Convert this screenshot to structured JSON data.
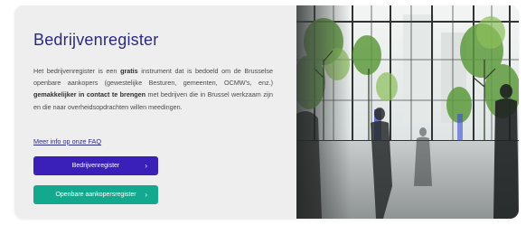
{
  "panel": {
    "title": "Bedrijvenregister",
    "intro": [
      "Het bedrijvenregister is een ",
      "gratis",
      " instrument dat is bedoeld om de Brusselse openbare aankopers (gewestelijke Besturen, gemeenten, OCMW’s, enz.) ",
      "gemakkelijker in contact te brengen",
      " met bedrijven die in Brussel werkzaam zijn en die naar overheidsopdrachten willen meedingen."
    ],
    "faq_link": "Meer info op onze FAQ",
    "buttons": [
      {
        "label": "Bedrijvenregister",
        "icon": "chevron-right-icon",
        "color": "#3a1fb8"
      },
      {
        "label": "Openbare aankopersregister",
        "icon": "chevron-right-icon",
        "color": "#13a98f"
      }
    ]
  },
  "photo": {
    "subject": "office-lobby-people-walking"
  },
  "colors": {
    "title": "#2b2a7d",
    "panel_bg": "#eeeeef",
    "primary": "#3a1fb8",
    "secondary": "#13a98f"
  }
}
